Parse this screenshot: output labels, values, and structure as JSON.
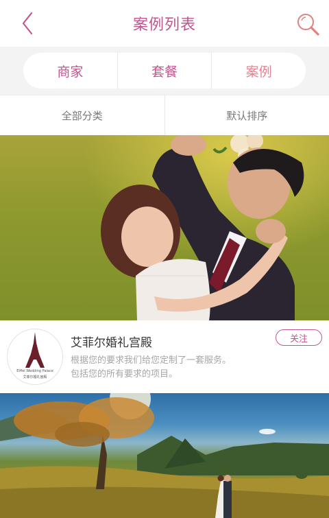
{
  "header": {
    "title": "案例列表",
    "back_icon": "chevron-left-icon",
    "search_icon": "search-icon",
    "accent_color": "#c2548f"
  },
  "tabs": [
    {
      "label": "商家",
      "active": false
    },
    {
      "label": "套餐",
      "active": false
    },
    {
      "label": "案例",
      "active": true
    }
  ],
  "filters": {
    "category": "全部分类",
    "sort": "默认排序"
  },
  "cases": [
    {
      "merchant_name": "艾菲尔婚礼宫殿",
      "follow_label": "关注",
      "description_line1": "根据您的要求我们给您定制了一套服务。",
      "description_line2": "包括您的所有要求的项目。",
      "logo_caption_en": "Eiffel Wedding Palace",
      "logo_caption_cn": "艾菲尔婚礼宫殿"
    }
  ]
}
